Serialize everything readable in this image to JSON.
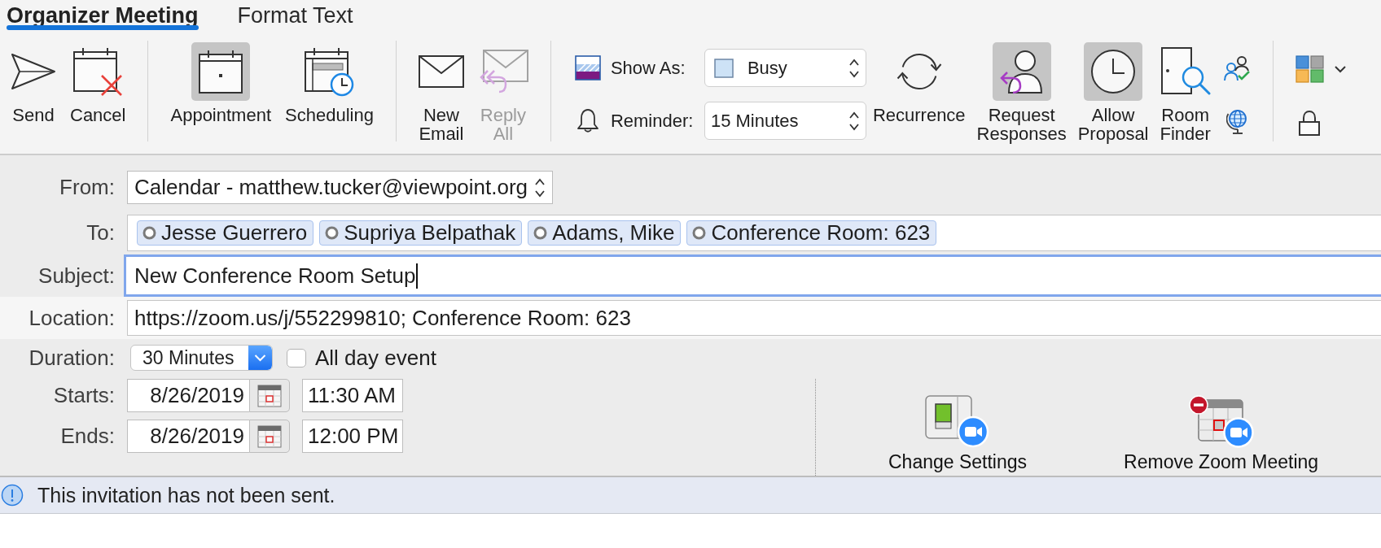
{
  "tabs": [
    {
      "label": "Organizer Meeting",
      "selected": true
    },
    {
      "label": "Format Text",
      "selected": false
    }
  ],
  "ribbon": {
    "groups": [
      {
        "buttons": [
          {
            "label": "Send",
            "selected": false,
            "disabled": false
          },
          {
            "label": "Cancel",
            "selected": false,
            "disabled": false
          }
        ]
      },
      {
        "buttons": [
          {
            "label": "Appointment",
            "selected": true,
            "disabled": false
          },
          {
            "label": "Scheduling",
            "selected": false,
            "disabled": false
          }
        ]
      },
      {
        "buttons": [
          {
            "label": "New Email",
            "selected": false,
            "disabled": false
          },
          {
            "label": "Reply All",
            "selected": false,
            "disabled": true
          }
        ]
      },
      {
        "show_as": {
          "label": "Show As:",
          "value": "Busy"
        },
        "reminder": {
          "label": "Reminder:",
          "value": "15 Minutes"
        },
        "buttons": [
          {
            "label": "Recurrence",
            "selected": false,
            "disabled": false
          },
          {
            "label": "Request Responses",
            "selected": true,
            "disabled": false
          },
          {
            "label": "Allow Proposal",
            "selected": true,
            "disabled": false
          },
          {
            "label": "Room Finder",
            "selected": false,
            "disabled": false
          }
        ]
      }
    ]
  },
  "form": {
    "from": {
      "label": "From:",
      "value": "Calendar - matthew.tucker@viewpoint.org"
    },
    "to": {
      "label": "To:",
      "recipients": [
        "Jesse Guerrero",
        "Supriya Belpathak",
        "Adams, Mike",
        "Conference Room: 623"
      ]
    },
    "subject": {
      "label": "Subject:",
      "value": "New Conference Room Setup",
      "focused": true
    },
    "location": {
      "label": "Location:",
      "value": "https://zoom.us/j/552299810; Conference Room: 623"
    },
    "duration": {
      "label": "Duration:",
      "value": "30 Minutes"
    },
    "all_day": {
      "label": "All day event",
      "checked": false
    },
    "starts": {
      "label": "Starts:",
      "date": "8/26/2019",
      "time": "11:30 AM"
    },
    "ends": {
      "label": "Ends:",
      "date": "8/26/2019",
      "time": "12:00 PM"
    }
  },
  "zoom_actions": [
    {
      "label": "Change Settings"
    },
    {
      "label": "Remove Zoom Meeting"
    }
  ],
  "info_bar": {
    "message": "This invitation has not been sent."
  }
}
